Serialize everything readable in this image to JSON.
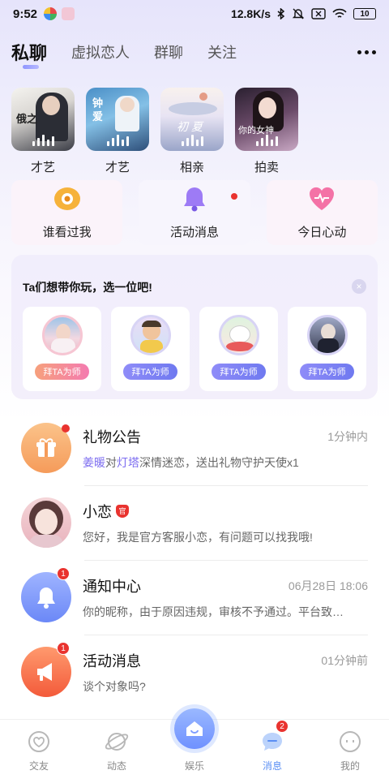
{
  "status_bar": {
    "time": "9:52",
    "network_speed": "12.8K/s",
    "battery": "10"
  },
  "tabs": [
    {
      "label": "私聊",
      "active": true
    },
    {
      "label": "虚拟恋人",
      "active": false
    },
    {
      "label": "群聊",
      "active": false
    },
    {
      "label": "关注",
      "active": false
    }
  ],
  "rooms": [
    {
      "label": "才艺",
      "overlay": "俄之"
    },
    {
      "label": "才艺",
      "overlay": "钟 爱"
    },
    {
      "label": "相亲",
      "overlay": "初 夏"
    },
    {
      "label": "拍卖",
      "overlay": "你的女神"
    }
  ],
  "quick_actions": [
    {
      "label": "谁看过我",
      "icon": "eye-icon",
      "dot": false
    },
    {
      "label": "活动消息",
      "icon": "bell-icon",
      "dot": true
    },
    {
      "label": "今日心动",
      "icon": "heart-icon",
      "dot": false
    }
  ],
  "mentor": {
    "title": "Ta们想带你玩，选一位吧!",
    "close": "×",
    "cards": [
      {
        "button": "拜TA为师",
        "accent": "#f48aa7"
      },
      {
        "button": "拜TA为师",
        "accent": "#8f7cf6"
      },
      {
        "button": "拜TA为师",
        "accent": "#8f7cf6"
      },
      {
        "button": "拜TA为师",
        "accent": "#8f7cf6"
      }
    ]
  },
  "messages": [
    {
      "name": "礼物公告",
      "time": "1分钟内",
      "preview_parts": [
        "姜暖",
        "对",
        "灯塔",
        "深情迷恋，送出礼物守护天使x1"
      ],
      "icon": "gift-icon",
      "dot": true
    },
    {
      "name": "小恋",
      "tag": "官",
      "time": "",
      "preview": "您好，我是官方客服小恋，有问题可以找我哦!",
      "icon": "avatar"
    },
    {
      "name": "通知中心",
      "time": "06月28日 18:06",
      "preview": "你的昵称，由于原因违规，审核不予通过。平台致…",
      "icon": "bell-icon",
      "badge": "1"
    },
    {
      "name": "活动消息",
      "time": "01分钟前",
      "preview": "谈个对象吗?",
      "icon": "megaphone-icon",
      "badge": "1"
    }
  ],
  "bottom_nav": [
    {
      "label": "交友",
      "icon": "heart-circle-icon"
    },
    {
      "label": "动态",
      "icon": "planet-icon"
    },
    {
      "label": "娱乐",
      "icon": "home-icon"
    },
    {
      "label": "消息",
      "icon": "chat-icon",
      "badge": "2",
      "active": true
    },
    {
      "label": "我的",
      "icon": "face-icon"
    }
  ],
  "colors": {
    "accent": "#7c6cf0",
    "active_nav": "#5b8ff4",
    "badge": "#e9332f"
  }
}
